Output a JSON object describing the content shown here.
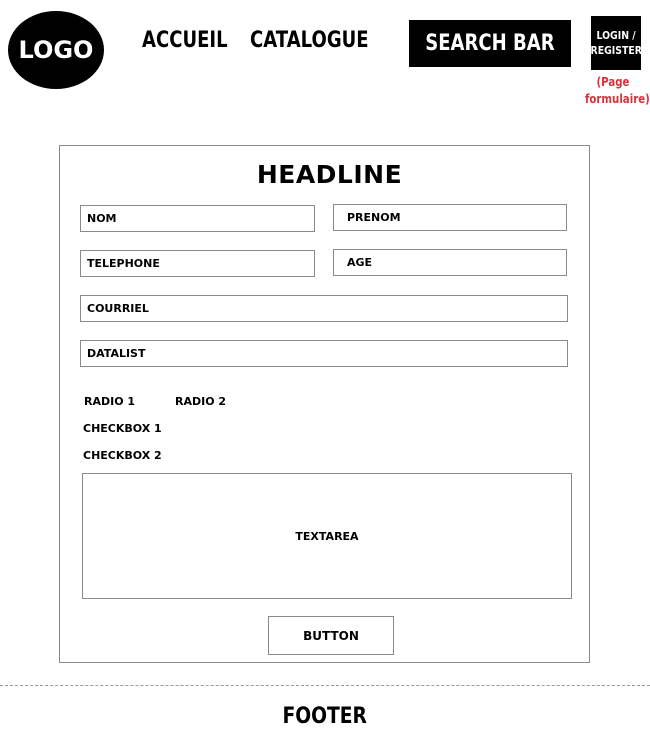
{
  "header": {
    "logo_text": "LOGO",
    "nav": {
      "home": "ACCUEIL",
      "catalog": "CATALOGUE"
    },
    "search_label": "SEARCH BAR",
    "login": {
      "line1": "LOGIN /",
      "line2": "REGISTER",
      "note_line1": "(Page",
      "note_line2": "formulaire)"
    }
  },
  "form": {
    "headline": "HEADLINE",
    "fields": {
      "nom": "NOM",
      "prenom": "PRENOM",
      "telephone": "TELEPHONE",
      "age": "AGE",
      "courriel": "COURRIEL",
      "datalist": "DATALIST"
    },
    "radios": [
      "RADIO 1",
      "RADIO 2"
    ],
    "checkboxes": [
      "CHECKBOX 1",
      "CHECKBOX 2"
    ],
    "textarea": "TEXTAREA",
    "button": "BUTTON"
  },
  "footer": {
    "label": "FOOTER"
  },
  "colors": {
    "note_red": "#d9323a",
    "border_gray": "#8a8a8a"
  }
}
